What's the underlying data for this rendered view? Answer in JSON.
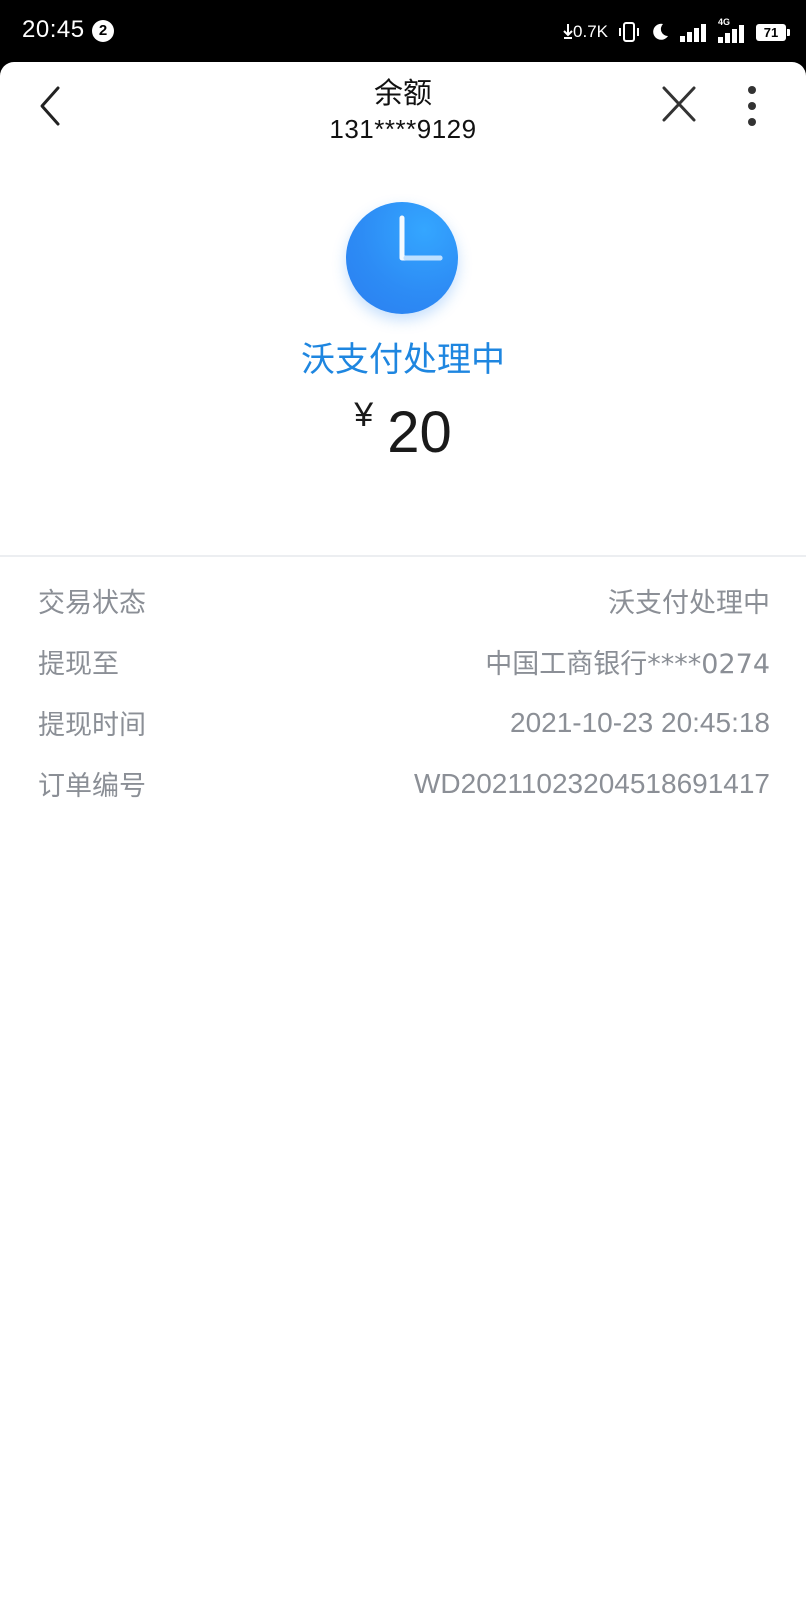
{
  "status_bar": {
    "time": "20:45",
    "notification_count": "2",
    "net_speed": "0.7K",
    "network_label": "4G",
    "battery": "71"
  },
  "header": {
    "title": "余额",
    "subtitle": "131****9129"
  },
  "status": {
    "icon": "clock-icon",
    "text": "沃支付处理中",
    "currency": "¥",
    "amount": "20"
  },
  "details": [
    {
      "label": "交易状态",
      "value": "沃支付处理中"
    },
    {
      "label": "提现至",
      "value": "中国工商银行****0274"
    },
    {
      "label": "提现时间",
      "value": "2021-10-23 20:45:18"
    },
    {
      "label": "订单编号",
      "value": "WD2021102320451869141​7"
    }
  ],
  "colors": {
    "accent": "#1e86e0",
    "icon_blue": "#2d8cf5",
    "muted_text": "#8b8f96"
  }
}
